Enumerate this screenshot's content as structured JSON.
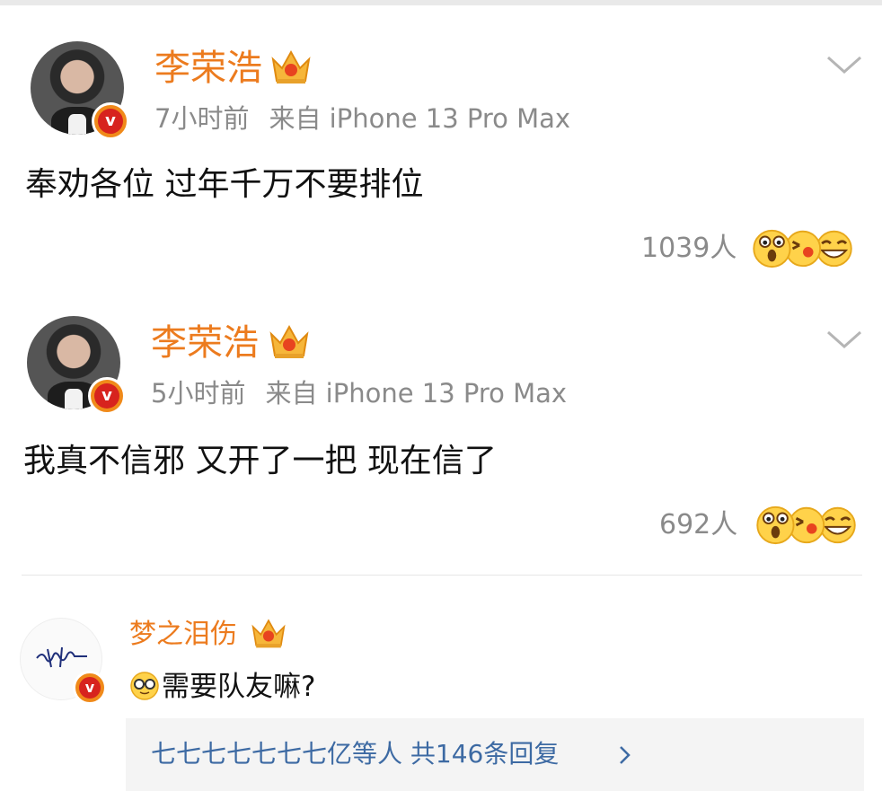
{
  "posts": [
    {
      "username": "李荣浩",
      "time": "7小时前",
      "source": "来自 iPhone 13 Pro Max",
      "text": "奉劝各位 过年千万不要排位",
      "reaction_count": "1039人",
      "icons": [
        "verified-v-icon",
        "crown-icon",
        "chevron-down-icon",
        "surprised-emoji-icon",
        "kiss-emoji-icon",
        "laugh-emoji-icon"
      ]
    },
    {
      "username": "李荣浩",
      "time": "5小时前",
      "source": "来自 iPhone 13 Pro Max",
      "text": "我真不信邪 又开了一把 现在信了",
      "reaction_count": "692人",
      "icons": [
        "verified-v-icon",
        "crown-icon",
        "chevron-down-icon",
        "surprised-emoji-icon",
        "kiss-emoji-icon",
        "laugh-emoji-icon"
      ]
    }
  ],
  "comment": {
    "username": "梦之泪伤",
    "text": "需要队友嘛?",
    "reply_summary": "七七七七七七七亿等人  共146条回复",
    "icons": [
      "signature-avatar",
      "verified-v-icon",
      "crown-icon",
      "glasses-emoji-icon",
      "chevron-right-icon"
    ]
  },
  "colors": {
    "username": "#ec7b1e",
    "meta": "#8a8a8a",
    "link": "#3d6aa3",
    "verified_badge": "#f08a1a"
  }
}
